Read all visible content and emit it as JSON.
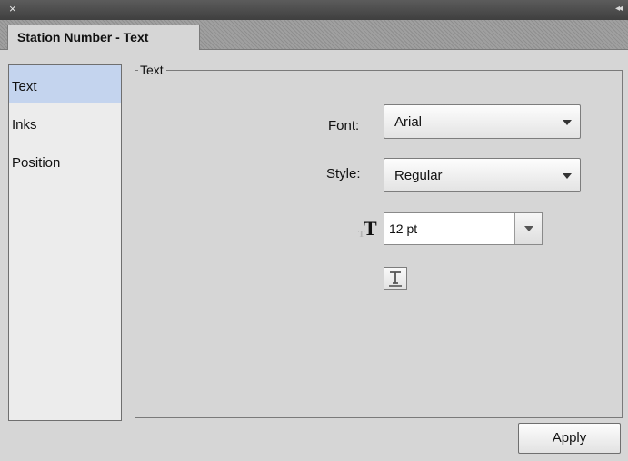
{
  "window": {
    "close_icon": "×",
    "collapse_icon": "◂◂"
  },
  "tab": {
    "title": "Station Number - Text"
  },
  "sidebar": {
    "items": [
      {
        "label": "Text",
        "selected": true
      },
      {
        "label": "Inks",
        "selected": false
      },
      {
        "label": "Position",
        "selected": false
      }
    ]
  },
  "group": {
    "legend": "Text"
  },
  "font": {
    "label": "Font:",
    "value": "Arial"
  },
  "style": {
    "label": "Style:",
    "value": "Regular"
  },
  "size": {
    "value": "12 pt",
    "icon": "font-size-icon"
  },
  "underline": {
    "icon": "underline-text-icon"
  },
  "apply": {
    "label": "Apply"
  }
}
